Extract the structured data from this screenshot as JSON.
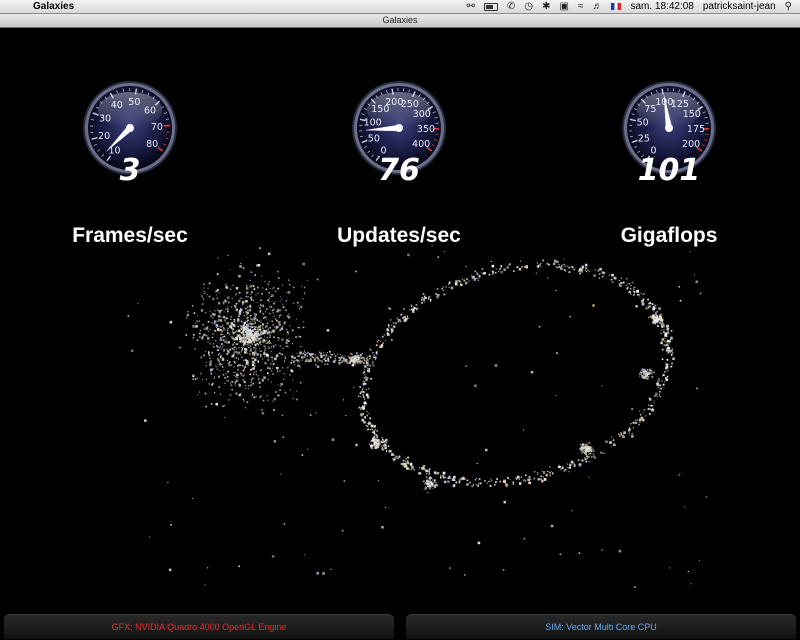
{
  "menubar": {
    "apple_glyph": "",
    "app_name": "Galaxies",
    "clock": "sam. 18:42:08",
    "user": "patricksaint-jean",
    "icons": [
      "accessibility-icon",
      "battery-icon",
      "phone-icon",
      "time-machine-icon",
      "bluetooth-icon",
      "display-icon",
      "wifi-icon",
      "volume-icon",
      "flag-fr-icon",
      "spotlight-icon"
    ]
  },
  "window": {
    "title": "Galaxies"
  },
  "gauges": [
    {
      "id": "fps",
      "value": "3",
      "label": "Frames/sec",
      "ticks": [
        "10",
        "20",
        "30",
        "40",
        "50",
        "60",
        "70",
        "80"
      ],
      "min": 0,
      "max": 80,
      "reading": 3
    },
    {
      "id": "ups",
      "value": "76",
      "label": "Updates/sec",
      "ticks": [
        "0",
        "50",
        "100",
        "150",
        "200",
        "250",
        "300",
        "350",
        "400"
      ],
      "min": 0,
      "max": 400,
      "reading": 76
    },
    {
      "id": "gflops",
      "value": "101",
      "label": "Gigaflops",
      "ticks": [
        "0",
        "25",
        "50",
        "75",
        "100",
        "125",
        "150",
        "175",
        "200"
      ],
      "min": 0,
      "max": 200,
      "reading": 101
    }
  ],
  "footer": {
    "gfx_text": "GFX: NVIDIA Quadro 4000 OpenGL Engine",
    "sim_text": "SIM: Vector Multi Core CPU",
    "gfx_color": "#e03030",
    "sim_color": "#6aa8e8"
  }
}
